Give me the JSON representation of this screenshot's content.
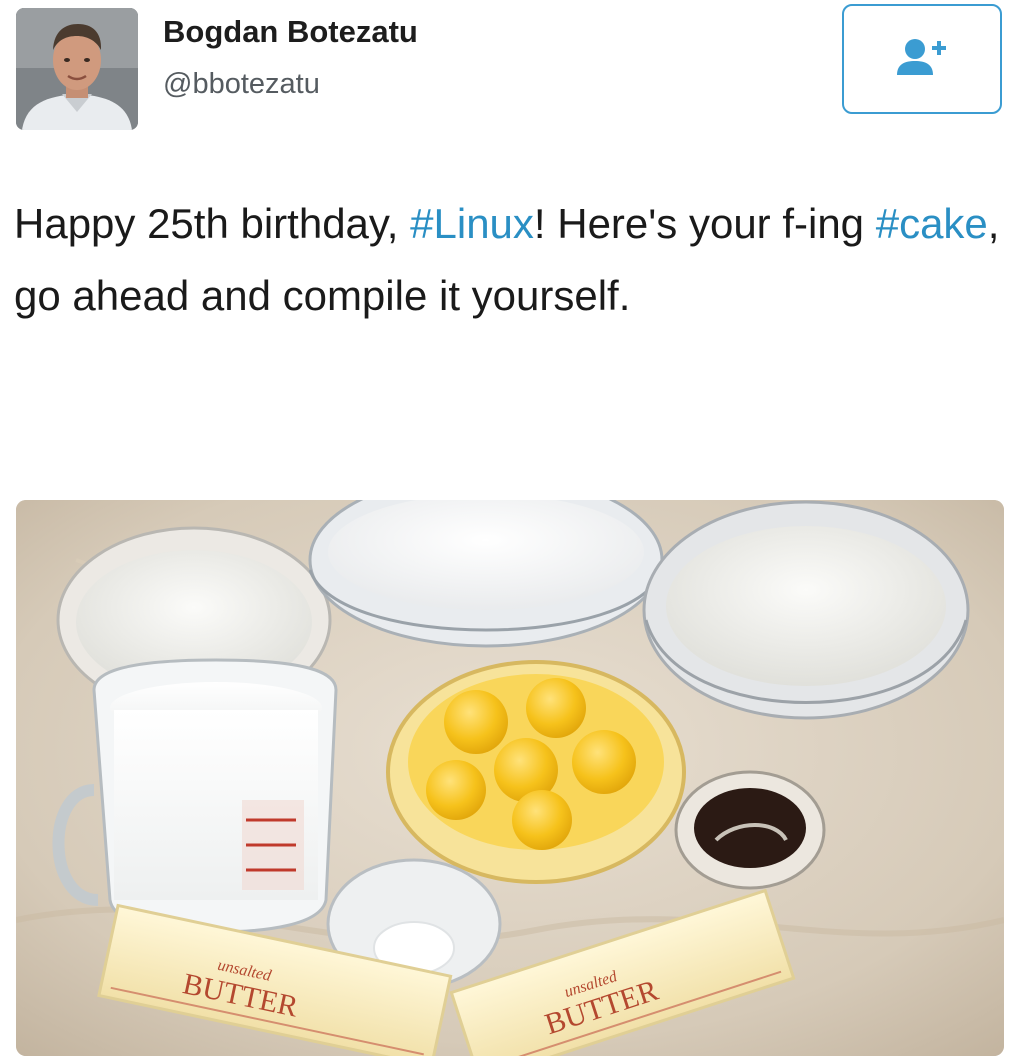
{
  "user": {
    "display_name": "Bogdan Botezatu",
    "handle": "@bbotezatu"
  },
  "follow_button": {
    "icon": "add-user-icon",
    "accent": "#3b9cd2"
  },
  "tweet": {
    "text_part_1": "Happy 25th birthday, ",
    "hashtag_1": "#Linux",
    "text_part_2": "! Here's your f-ing ",
    "hashtag_2": "#cake",
    "text_part_3": ", go ahead and compile it yourself.",
    "hashtag_color": "#2a8fc4"
  },
  "media": {
    "butter_label_left": "BUTTER",
    "butter_label_right": "BUTTER",
    "butter_sub_left": "unsalted",
    "butter_sub_right": "unsalted"
  }
}
